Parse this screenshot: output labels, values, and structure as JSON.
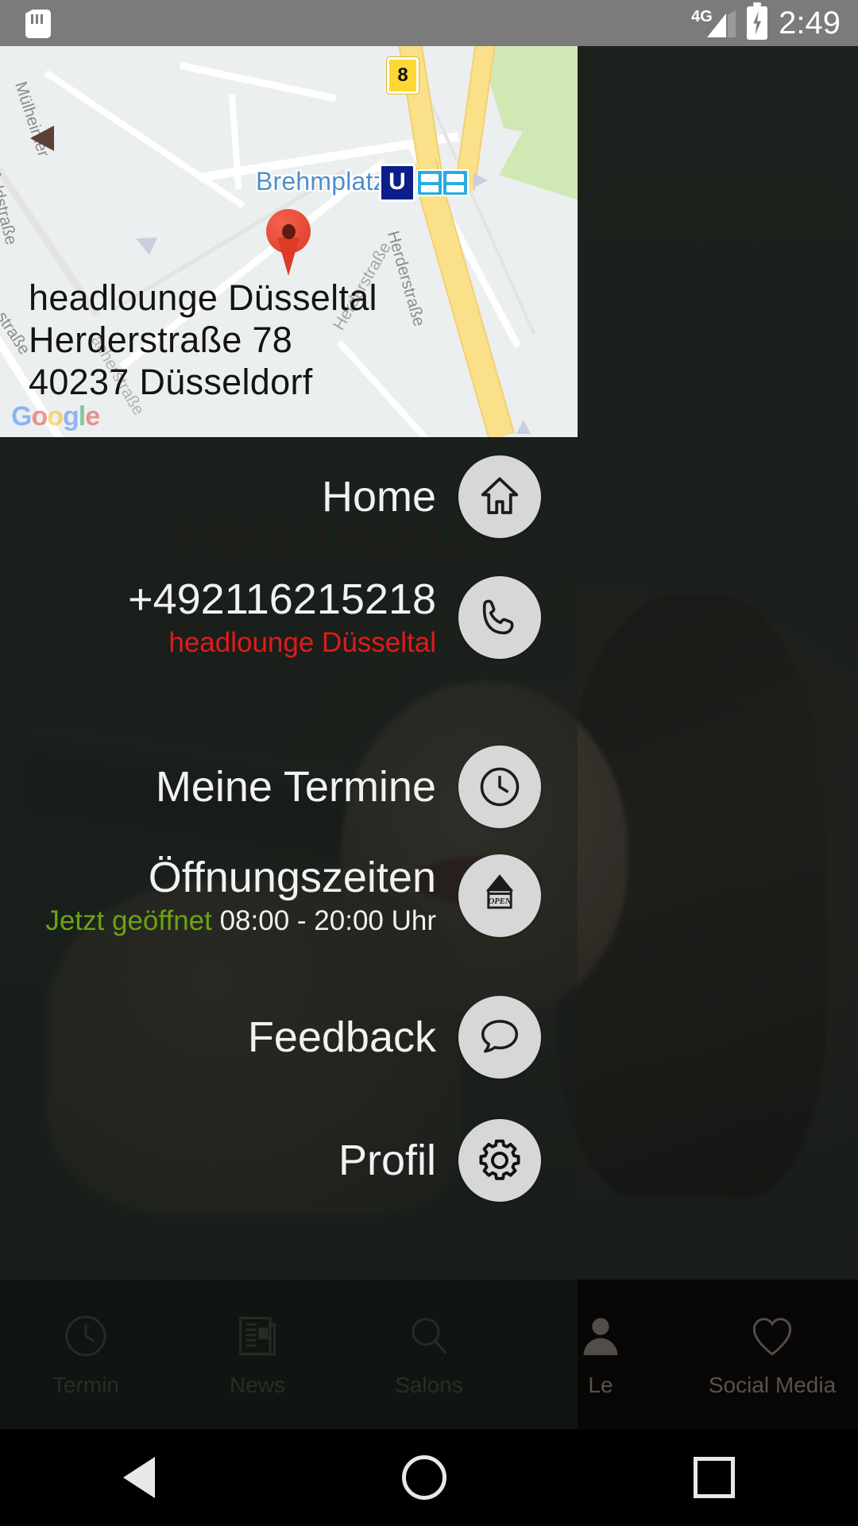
{
  "status_bar": {
    "sd_icon": "sd-card-icon",
    "network": "4G",
    "signal_icon": "signal-bars-icon",
    "battery_icon": "battery-charging-icon",
    "time": "2:49"
  },
  "map_card": {
    "provider_logo": "google-logo",
    "logo_letters": [
      "G",
      "o",
      "o",
      "g",
      "l",
      "e"
    ],
    "place_name": "headlounge Düsseltal",
    "street": "Herderstraße 78",
    "city": "40237 Düsseldorf",
    "pin_icon": "map-pin-icon",
    "transit_label": "Brehmplatz",
    "transit_icons": [
      "u-bahn-icon",
      "tram-icon",
      "bus-icon"
    ],
    "u_bahn_letter": "U",
    "highway_shield": "8",
    "street_labels": [
      "Mülheimer",
      "Ahnfeldstraße",
      "Herderstraße",
      "Herderstraße",
      "straße",
      "acherstraße"
    ]
  },
  "background": {
    "headline": "Hereinspazie"
  },
  "menu": {
    "items": [
      {
        "label": "Home",
        "icon": "home-icon",
        "sub": null
      },
      {
        "label": "+492116215218",
        "icon": "phone-icon",
        "sub": "headlounge Düsseltal"
      },
      {
        "label": "Meine Termine",
        "icon": "clock-icon",
        "sub": null
      },
      {
        "label": "Öffnungszeiten",
        "icon": "open-sign-icon",
        "sub_open": "Jetzt geöffnet",
        "sub_hours": "08:00 - 20:00 Uhr"
      },
      {
        "label": "Feedback",
        "icon": "speech-bubble-icon",
        "sub": null
      },
      {
        "label": "Profil",
        "icon": "gear-icon",
        "sub": null
      }
    ],
    "colors": {
      "label": "#f2f2f2",
      "phone_sub": "#e01b1b",
      "open_now": "#6ca313",
      "fab_bg": "#d7d7d7"
    }
  },
  "tab_bar": {
    "tabs": [
      {
        "label": "Termin",
        "icon": "clock-icon"
      },
      {
        "label": "News",
        "icon": "newspaper-icon"
      },
      {
        "label": "Salons",
        "icon": "search-icon"
      },
      {
        "label": "Le",
        "icon": "person-icon"
      },
      {
        "label": "Social Media",
        "icon": "heart-icon"
      }
    ]
  },
  "nav_bar": {
    "back": "back-triangle-icon",
    "home": "home-circle-icon",
    "recents": "recents-square-icon"
  }
}
